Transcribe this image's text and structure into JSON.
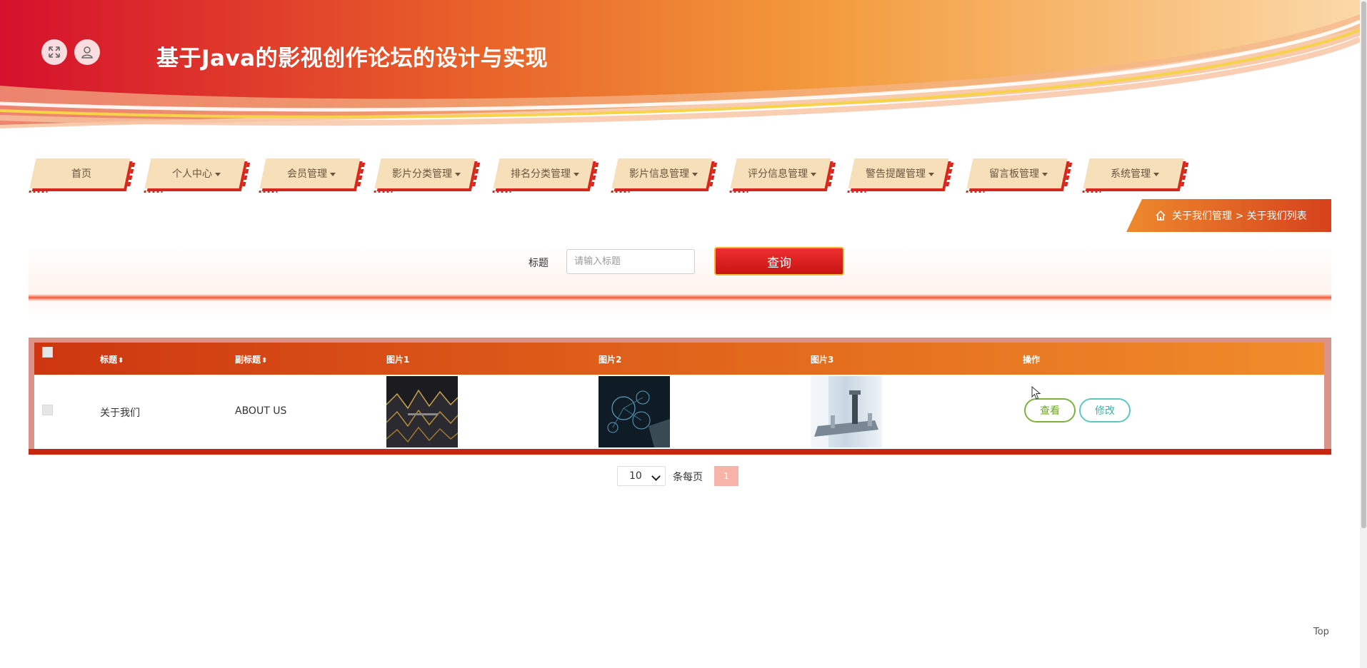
{
  "header": {
    "title": "基于Java的影视创作论坛的设计与实现",
    "fullscreen_icon": "expand-icon",
    "user_icon": "user-icon"
  },
  "nav": {
    "items": [
      {
        "label": "首页",
        "dropdown": false
      },
      {
        "label": "个人中心",
        "dropdown": true
      },
      {
        "label": "会员管理",
        "dropdown": true
      },
      {
        "label": "影片分类管理",
        "dropdown": true
      },
      {
        "label": "排名分类管理",
        "dropdown": true
      },
      {
        "label": "影片信息管理",
        "dropdown": true
      },
      {
        "label": "评分信息管理",
        "dropdown": true
      },
      {
        "label": "警告提醒管理",
        "dropdown": true
      },
      {
        "label": "留言板管理",
        "dropdown": true
      },
      {
        "label": "系统管理",
        "dropdown": true
      }
    ]
  },
  "breadcrumb": {
    "icon": "home-icon",
    "text": "关于我们管理 > 关于我们列表"
  },
  "search": {
    "label": "标题",
    "placeholder": "请输入标题",
    "value": "",
    "button": "查询"
  },
  "table": {
    "columns": {
      "title": "标题",
      "subtitle": "副标题",
      "image1": "图片1",
      "image2": "图片2",
      "image3": "图片3",
      "actions": "操作"
    },
    "rows": [
      {
        "title": "关于我们",
        "subtitle": "ABOUT US",
        "view": "查看",
        "edit": "修改"
      }
    ]
  },
  "pagination": {
    "page_size": "10",
    "per_page_label": "条每页",
    "current_page": "1"
  },
  "top_link": "Top",
  "colors": {
    "primary_red": "#d8261d",
    "header_orange": "#e2681c",
    "tab_bg": "#f6dfb9"
  }
}
